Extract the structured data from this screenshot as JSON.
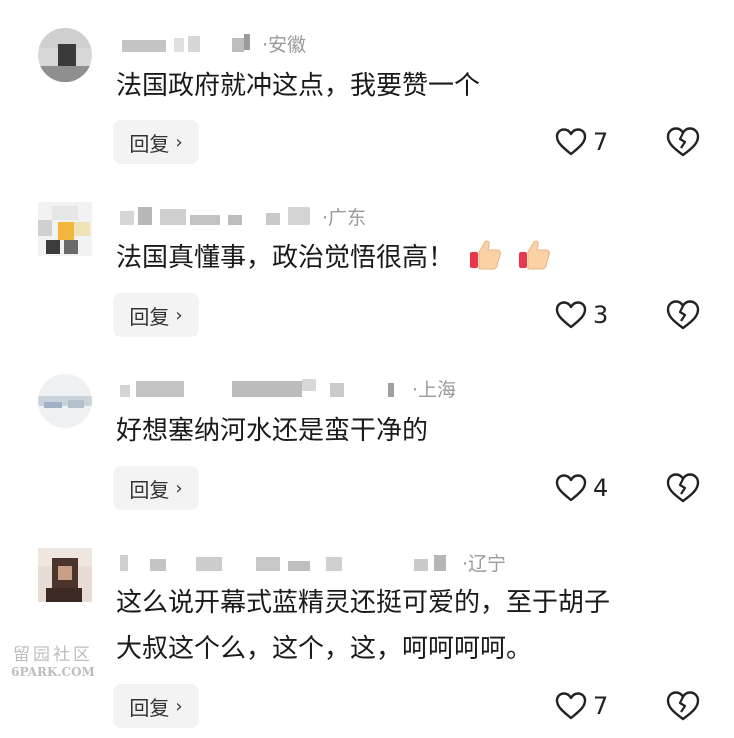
{
  "comments": [
    {
      "location": "·安徽",
      "text": "法国政府就冲这点，我要赞一个",
      "reply_label": "回复",
      "likes": "7"
    },
    {
      "location": "·广东",
      "text": "法国真懂事，政治觉悟很高！",
      "reply_label": "回复",
      "likes": "3"
    },
    {
      "location": "·上海",
      "text": "好想塞纳河水还是蛮干净的",
      "reply_label": "回复",
      "likes": "4"
    },
    {
      "location": "·辽宁",
      "text_line1": "这么说开幕式蓝精灵还挺可爱的，至于胡子",
      "text_line2": "大叔这个么，这个，这，呵呵呵呵。",
      "reply_label": "回复",
      "likes": "7"
    }
  ],
  "icons": {
    "like": "heart-outline-icon",
    "dislike": "broken-heart-icon",
    "reply_chevron": "chevron-right-icon",
    "emoji": "thumbs-up-emoji"
  },
  "watermark": {
    "line1": "留园社区",
    "line2": "6PARK.COM"
  }
}
